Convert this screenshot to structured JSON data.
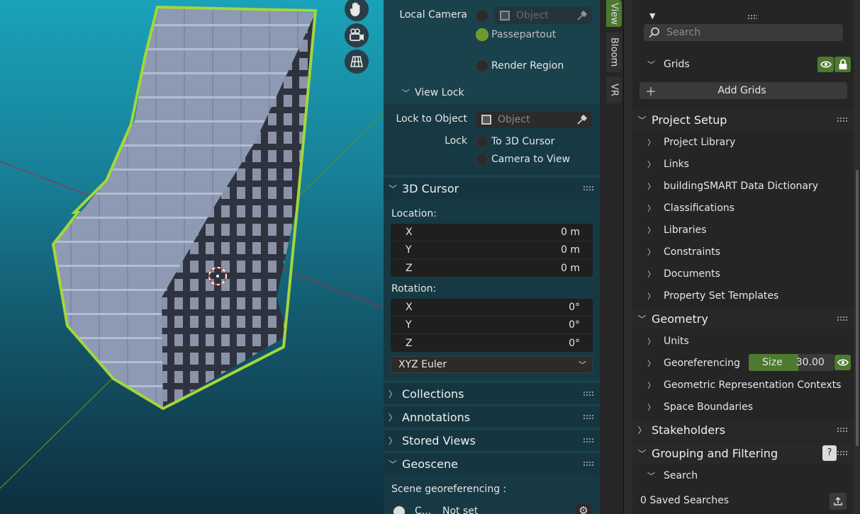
{
  "colors": {
    "accent_green": "#4d7a2f",
    "radio_on": "#6e9a2c",
    "panel_bg": "#1a424d",
    "props_bg": "#252525"
  },
  "viewport": {
    "nav_icons": [
      "hand-pan-icon",
      "camera-fly-icon",
      "grid-ortho-icon"
    ]
  },
  "npanel": {
    "local_camera_label": "Local Camera",
    "local_camera_placeholder": "Object",
    "passepartout_label": "Passepartout",
    "render_region_label": "Render Region",
    "view_lock_label": "View Lock",
    "lock_to_object_label": "Lock to Object",
    "lock_to_object_placeholder": "Object",
    "lock_label": "Lock",
    "to_3d_cursor_label": "To 3D Cursor",
    "camera_to_view_label": "Camera to View",
    "cursor_header": "3D Cursor",
    "location_label": "Location:",
    "location": [
      {
        "axis": "X",
        "value": "0 m"
      },
      {
        "axis": "Y",
        "value": "0 m"
      },
      {
        "axis": "Z",
        "value": "0 m"
      }
    ],
    "rotation_label": "Rotation:",
    "rotation": [
      {
        "axis": "X",
        "value": "0°"
      },
      {
        "axis": "Y",
        "value": "0°"
      },
      {
        "axis": "Z",
        "value": "0°"
      }
    ],
    "rotation_mode": "XYZ Euler",
    "collections_header": "Collections",
    "annotations_header": "Annotations",
    "stored_views_header": "Stored Views",
    "geoscene_header": "Geoscene",
    "scene_georef_label": "Scene georeferencing :",
    "crs_label": "C...",
    "crs_value": "Not set"
  },
  "vtabs": {
    "view": "View",
    "bloom": "Bloom",
    "vr": "VR"
  },
  "props": {
    "search_placeholder": "Search",
    "grids_label": "Grids",
    "add_grids_label": "Add Grids",
    "project_setup": {
      "header": "Project Setup",
      "items": [
        "Project Library",
        "Links",
        "buildingSMART Data Dictionary",
        "Classifications",
        "Libraries",
        "Constraints",
        "Documents",
        "Property Set Templates"
      ]
    },
    "geometry": {
      "header": "Geometry",
      "units": "Units",
      "georeferencing": "Georeferencing",
      "size_label": "Size",
      "size_value": "30.00",
      "geometric_rep": "Geometric Representation Contexts",
      "space_boundaries": "Space Boundaries"
    },
    "stakeholders_header": "Stakeholders",
    "grouping_header": "Grouping and Filtering",
    "search_label": "Search",
    "saved_searches": "0 Saved Searches"
  }
}
